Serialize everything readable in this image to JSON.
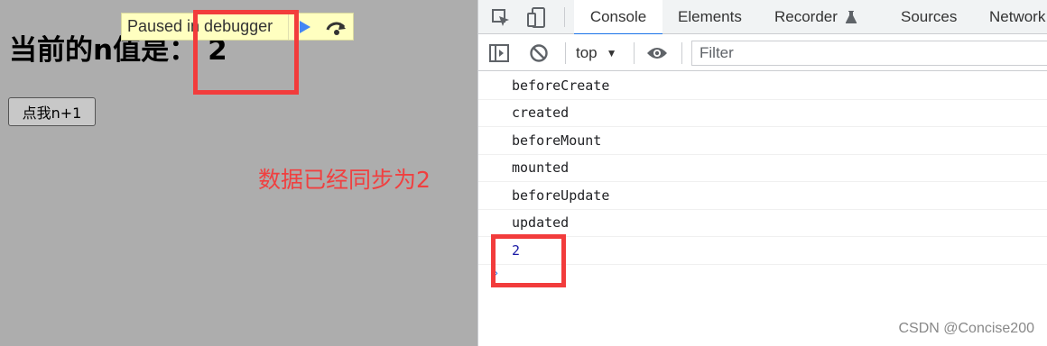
{
  "page": {
    "heading_label": "当前的n值是：",
    "heading_value": "2",
    "button_label": "点我n+1",
    "annotation_note": "数据已经同步为2"
  },
  "debugger_banner": {
    "text": "Paused in debugger",
    "resume_icon": "resume-icon",
    "step_over_icon": "step-over-icon"
  },
  "devtools": {
    "tabs": [
      {
        "label": "Console",
        "active": true
      },
      {
        "label": "Elements",
        "active": false
      },
      {
        "label": "Recorder",
        "active": false,
        "icon": "flask-icon"
      },
      {
        "label": "Sources",
        "active": false
      },
      {
        "label": "Network",
        "active": false
      }
    ],
    "toolbar": {
      "context": "top",
      "filter_placeholder": "Filter"
    },
    "console_lines": [
      "beforeCreate",
      "created",
      "beforeMount",
      "mounted",
      "beforeUpdate",
      "updated",
      "2"
    ],
    "prompt_glyph": "›"
  },
  "watermark": "CSDN @Concise200",
  "colors": {
    "annotation_red": "#f23c3c",
    "active_tab_underline": "#1a73e8",
    "paused_overlay": "#adadad",
    "banner_bg": "#ffffc0"
  }
}
